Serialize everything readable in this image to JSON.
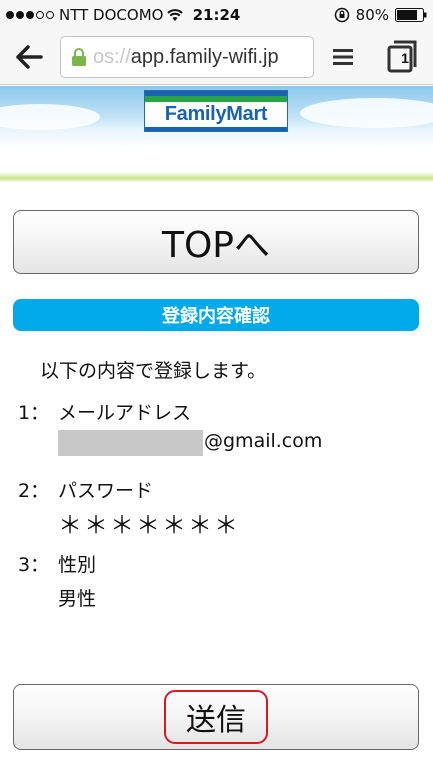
{
  "status_bar": {
    "carrier": "NTT DOCOMO",
    "time": "21:24",
    "battery": "80%",
    "battery_level": 0.8,
    "signal_bars": 3
  },
  "browser": {
    "url_scheme": "os://",
    "url_host": "app.family-wifi.jp",
    "tab_count": "1"
  },
  "header": {
    "logo_text": "FamilyMart"
  },
  "buttons": {
    "top_label": "TOPへ",
    "submit_label": "送信"
  },
  "section": {
    "title": "登録内容確認"
  },
  "content": {
    "intro": "以下の内容で登録します。",
    "items": [
      {
        "num": "1：",
        "label": "メールアドレス",
        "value": "@gmail.com"
      },
      {
        "num": "2：",
        "label": "パスワード",
        "value": "＊＊＊＊＊＊＊"
      },
      {
        "num": "3：",
        "label": "性別",
        "value": "男性"
      }
    ]
  },
  "colors": {
    "accent": "#00a9ea",
    "highlight": "#d51b24",
    "brand_blue": "#1a63b0",
    "brand_green": "#2aa345"
  }
}
